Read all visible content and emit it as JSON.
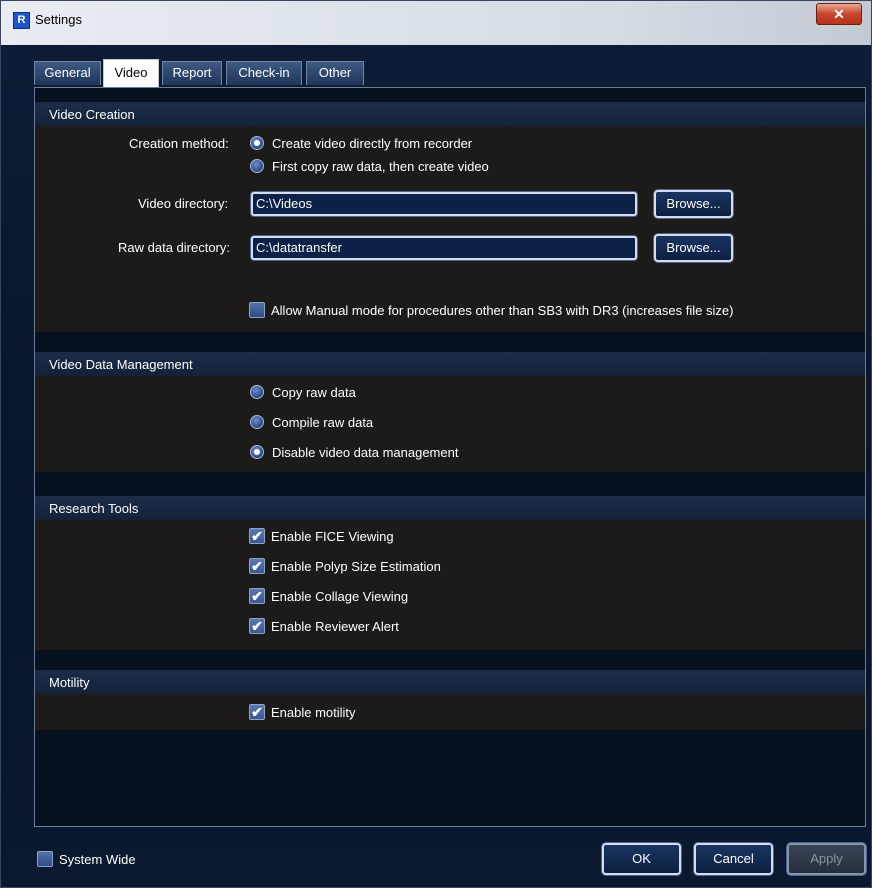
{
  "window": {
    "title": "Settings",
    "app_icon": "R",
    "close_glyph": "✕"
  },
  "tabs": [
    {
      "label": "General",
      "active": false
    },
    {
      "label": "Video",
      "active": true
    },
    {
      "label": "Report",
      "active": false
    },
    {
      "label": "Check-in",
      "active": false
    },
    {
      "label": "Other",
      "active": false
    }
  ],
  "video_creation": {
    "title": "Video Creation",
    "creation_method_label": "Creation method:",
    "options": [
      {
        "label": "Create video directly from recorder",
        "selected": true
      },
      {
        "label": "First copy raw data, then create video",
        "selected": false
      }
    ],
    "video_directory_label": "Video directory:",
    "video_directory_value": "C:\\Videos",
    "raw_data_directory_label": "Raw data directory:",
    "raw_data_directory_value": "C:\\datatransfer",
    "browse_label": "Browse...",
    "manual_mode_label": "Allow Manual mode for procedures other than SB3 with DR3 (increases file size)",
    "manual_mode_checked": false
  },
  "video_data_management": {
    "title": "Video Data Management",
    "options": [
      {
        "label": "Copy raw data",
        "selected": false
      },
      {
        "label": "Compile raw data",
        "selected": false
      },
      {
        "label": "Disable video data management",
        "selected": true
      }
    ]
  },
  "research_tools": {
    "title": "Research Tools",
    "items": [
      {
        "label": "Enable FICE Viewing",
        "checked": true
      },
      {
        "label": "Enable Polyp Size Estimation",
        "checked": true
      },
      {
        "label": "Enable Collage Viewing",
        "checked": true
      },
      {
        "label": "Enable Reviewer Alert",
        "checked": true
      }
    ]
  },
  "motility": {
    "title": "Motility",
    "items": [
      {
        "label": "Enable motility",
        "checked": true
      }
    ]
  },
  "footer": {
    "system_wide_label": "System Wide",
    "system_wide_checked": false,
    "ok_label": "OK",
    "cancel_label": "Cancel",
    "apply_label": "Apply"
  },
  "check_glyph": "✔"
}
